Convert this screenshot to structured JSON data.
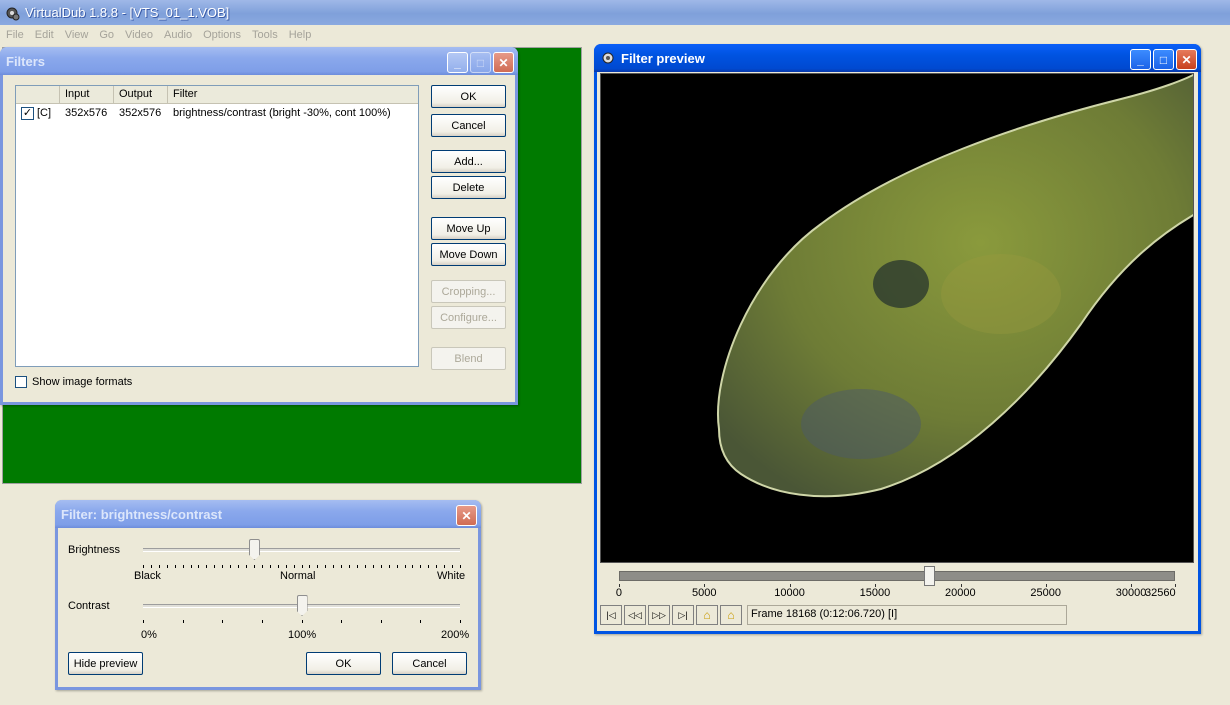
{
  "app": {
    "title": "VirtualDub 1.8.8 - [VTS_01_1.VOB]",
    "menu": [
      "File",
      "Edit",
      "View",
      "Go",
      "Video",
      "Audio",
      "Options",
      "Tools",
      "Help"
    ]
  },
  "filters_dialog": {
    "title": "Filters",
    "columns": [
      "",
      "Input",
      "Output",
      "Filter"
    ],
    "rows": [
      {
        "checked": true,
        "flag": "[C]",
        "input": "352x576",
        "output": "352x576",
        "filter": "brightness/contrast (bright -30%, cont 100%)"
      }
    ],
    "buttons": {
      "ok": "OK",
      "cancel": "Cancel",
      "add": "Add...",
      "delete": "Delete",
      "move_up": "Move Up",
      "move_down": "Move Down",
      "cropping": "Cropping...",
      "configure": "Configure...",
      "blend": "Blend"
    },
    "show_formats_label": "Show image formats",
    "show_formats_checked": false
  },
  "bc_dialog": {
    "title": "Filter: brightness/contrast",
    "brightness": {
      "label": "Brightness",
      "value_percent": -30,
      "left": "Black",
      "mid": "Normal",
      "right": "White"
    },
    "contrast": {
      "label": "Contrast",
      "value_percent": 100,
      "left": "0%",
      "mid": "100%",
      "right": "200%"
    },
    "buttons": {
      "hide_preview": "Hide preview",
      "ok": "OK",
      "cancel": "Cancel"
    }
  },
  "preview": {
    "title": "Filter preview",
    "timeline": {
      "labels": [
        "0",
        "5000",
        "10000",
        "15000",
        "20000",
        "25000",
        "30000",
        "32560"
      ],
      "max": 32560,
      "current_frame": 18168
    },
    "frame_text": "Frame 18168 (0:12:06.720) [I]",
    "nav_buttons": [
      "start-icon",
      "prev-key-icon",
      "next-key-icon",
      "end-icon",
      "mark-in-icon",
      "mark-out-icon"
    ]
  },
  "colors": {
    "video_bg": "#007a00",
    "active_title": "#0054e3",
    "inactive_title": "#7a96df"
  }
}
